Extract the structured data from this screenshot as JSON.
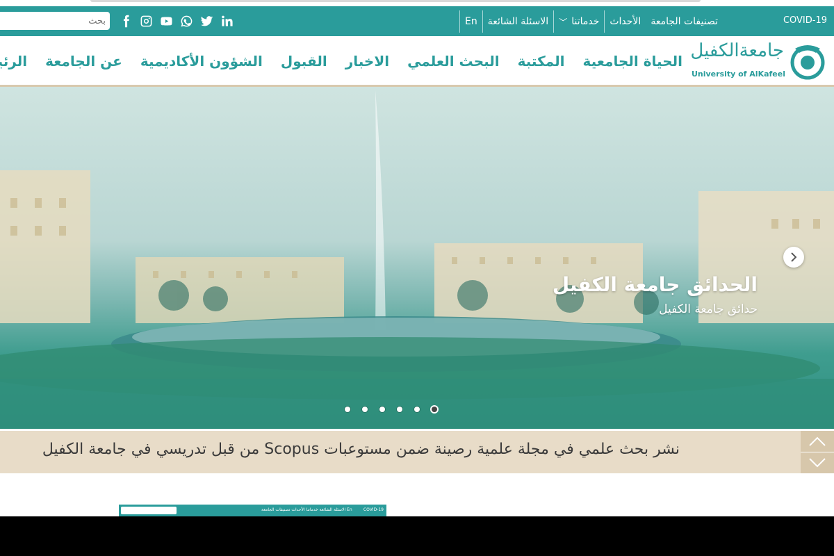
{
  "search": {
    "placeholder": "بحث"
  },
  "topnav": {
    "covid": "COVID-19",
    "language": "En",
    "faq": "الاسئلة الشائعة",
    "services": "خدماتنا",
    "events": "الأحداث",
    "rankings": "تصنيفات الجامعة"
  },
  "social_icons": [
    "facebook-icon",
    "instagram-icon",
    "youtube-icon",
    "whatsapp-icon",
    "twitter-icon",
    "linkedin-icon"
  ],
  "logo": {
    "arabic": "جامعةالكفيل",
    "english": "University of AlKafeel"
  },
  "mainnav": [
    "الرئيسية",
    "عن الجامعة",
    "الشؤون الأكاديمية",
    "القبول",
    "الاخبار",
    "البحث العلمي",
    "المكتبة",
    "الحياة الجامعية"
  ],
  "hero": {
    "title": "الحدائق جامعة الكفيل",
    "subtitle": "حدائق جامعة الكفيل",
    "slide_count": 6,
    "active_slide": 6
  },
  "ticker": {
    "text": "نشر بحث علمي في مجلة علمية رصينة ضمن مستوعبات Scopus من قبل تدريسي في جامعة الكفيل"
  },
  "colors": {
    "primary": "#2a9c9b",
    "beige": "#e8dcc8",
    "beige_dark": "#d7c7ab"
  }
}
